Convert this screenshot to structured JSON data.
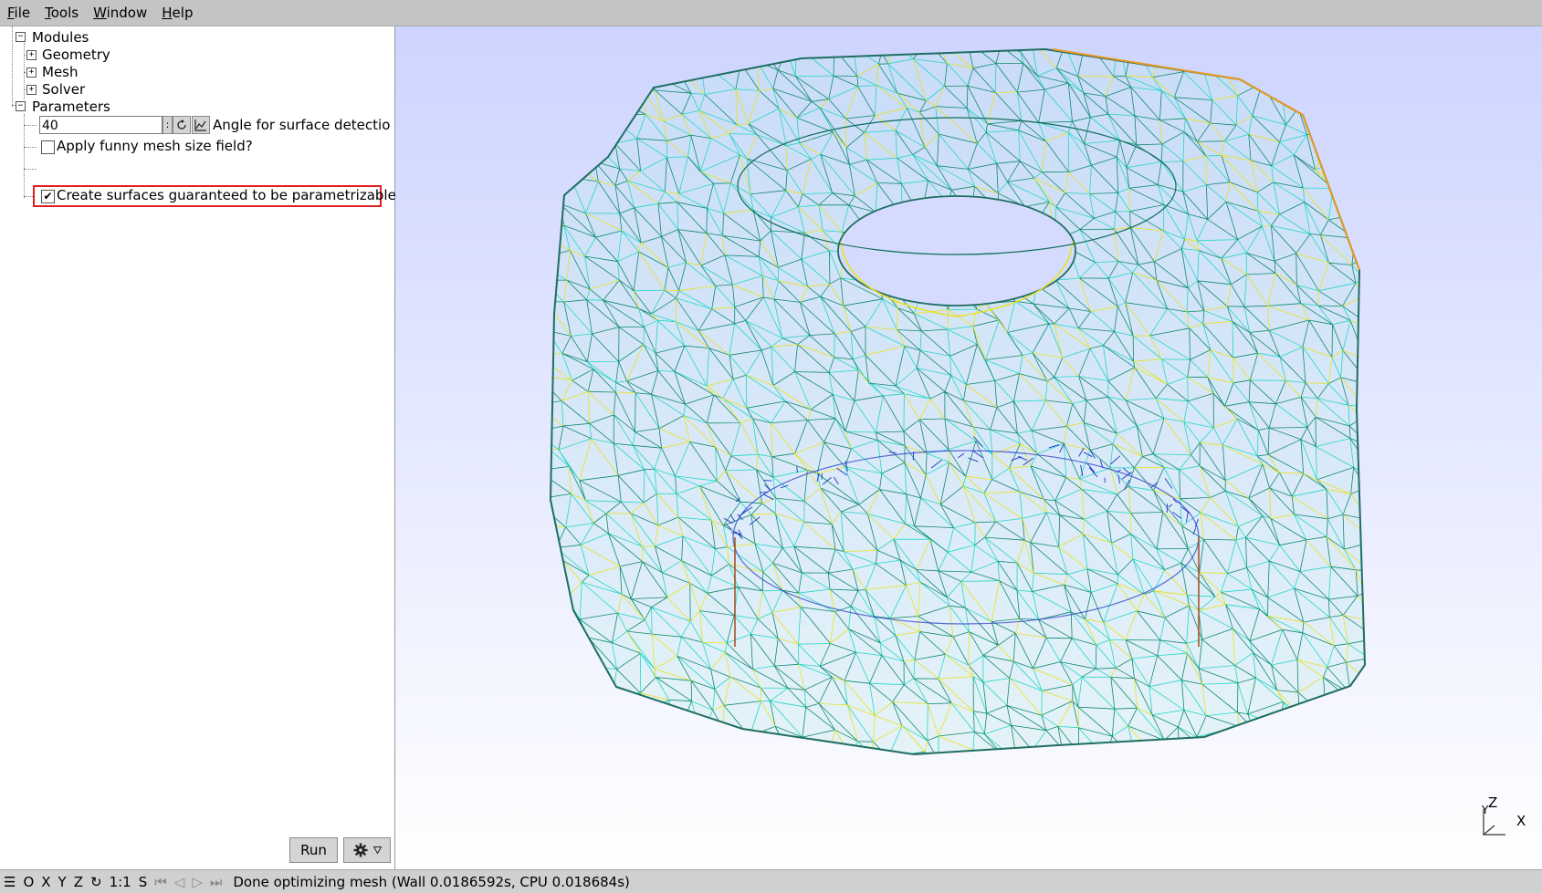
{
  "menu": {
    "file": {
      "m": "F",
      "rest": "ile"
    },
    "tools": {
      "m": "T",
      "rest": "ools"
    },
    "window": {
      "m": "W",
      "rest": "indow"
    },
    "help": {
      "m": "H",
      "rest": "elp"
    }
  },
  "tree": {
    "modules": "Modules",
    "geometry": "Geometry",
    "mesh": "Mesh",
    "solver": "Solver",
    "parameters": "Parameters"
  },
  "params": {
    "angle_value": "40",
    "angle_label": "Angle for surface detectio",
    "funny_label": "Apply funny mesh size field?",
    "funny_checked": false,
    "param_label": "Create surfaces guaranteed to be parametrizable",
    "param_checked": true
  },
  "buttons": {
    "run": "Run"
  },
  "axes": {
    "z": "Z",
    "y": "Y",
    "x": "X"
  },
  "status": {
    "o": "O",
    "x": "X",
    "y": "Y",
    "z": "Z",
    "scale": "1:1",
    "s": "S",
    "message": "Done optimizing mesh (Wall 0.0186592s, CPU 0.018684s)"
  },
  "icons": {
    "menu": "hamburger-icon",
    "rotate": "rotate-icon",
    "plot": "plot-icon",
    "gear": "gear-icon",
    "dropdown": "dropdown-triangle-icon"
  },
  "colors": {
    "highlight": "#e02020",
    "mesh_cyan": "#23d7c8",
    "mesh_green": "#0f8a6e",
    "mesh_yellow": "#e9e21e",
    "mesh_blue": "#1e32c8",
    "mesh_orange": "#e89a1e"
  }
}
